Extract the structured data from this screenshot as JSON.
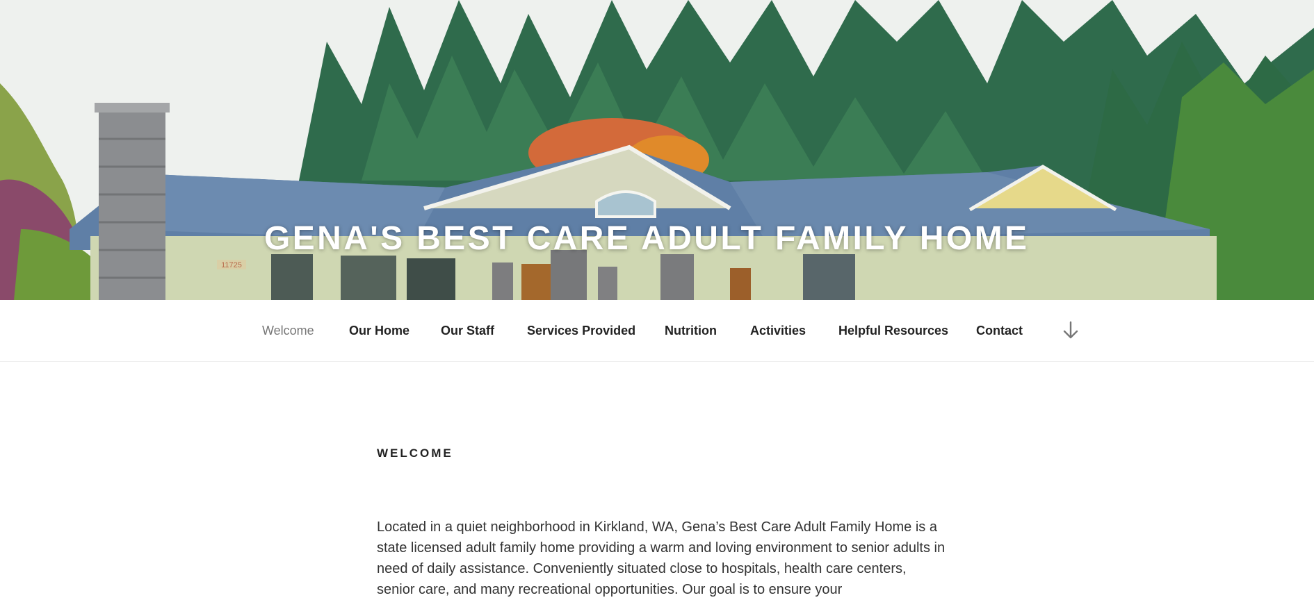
{
  "site": {
    "title": "GENA'S BEST CARE ADULT FAMILY HOME",
    "house_number": "11725"
  },
  "nav": {
    "items": [
      {
        "label": "Welcome",
        "current": true
      },
      {
        "label": "Our Home"
      },
      {
        "label": "Our Staff"
      },
      {
        "label": "Services Provided"
      },
      {
        "label": "Nutrition"
      },
      {
        "label": "Activities"
      },
      {
        "label": "Helpful Resources"
      },
      {
        "label": "Contact"
      }
    ],
    "scroll_icon": "arrow-down-icon"
  },
  "page": {
    "heading": "WELCOME",
    "intro": "Located in a quiet neighborhood in Kirkland, WA, Gena’s Best Care Adult Family Home is a state licensed adult family home providing a warm and loving environment to senior adults in need of daily assistance. Conveniently situated close to hospitals, health care centers, senior care, and many recreational opportunities. Our goal is to ensure your"
  },
  "colors": {
    "nav_text": "#222222",
    "nav_current": "#767676",
    "body_text": "#333333",
    "title_text": "#ffffff"
  }
}
